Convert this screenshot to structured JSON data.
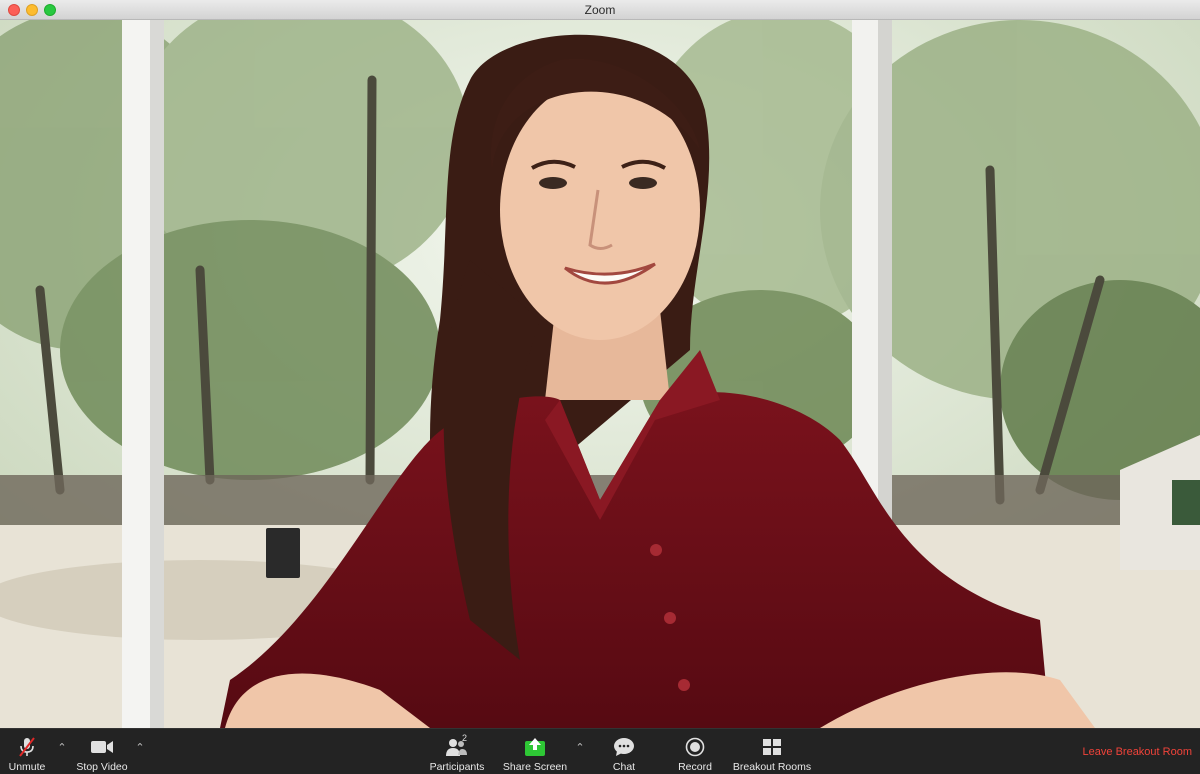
{
  "window": {
    "title": "Zoom"
  },
  "toolbar": {
    "unmute_label": "Unmute",
    "stop_video_label": "Stop Video",
    "participants_label": "Participants",
    "participants_count": "2",
    "share_screen_label": "Share Screen",
    "chat_label": "Chat",
    "record_label": "Record",
    "breakout_rooms_label": "Breakout Rooms",
    "leave_breakout_room_label": "Leave Breakout Room",
    "caret": "⌃"
  },
  "colors": {
    "leave_text": "#f0433a",
    "share_screen_icon": "#2ec735",
    "mute_slash": "#e02828",
    "shirt": "#6b0f17"
  },
  "icons": {
    "unmute": "microphone-muted-icon",
    "stop_video": "video-camera-icon",
    "participants": "participants-icon",
    "share_screen": "share-screen-icon",
    "chat": "chat-bubble-icon",
    "record": "record-icon",
    "breakout_rooms": "breakout-rooms-icon"
  }
}
